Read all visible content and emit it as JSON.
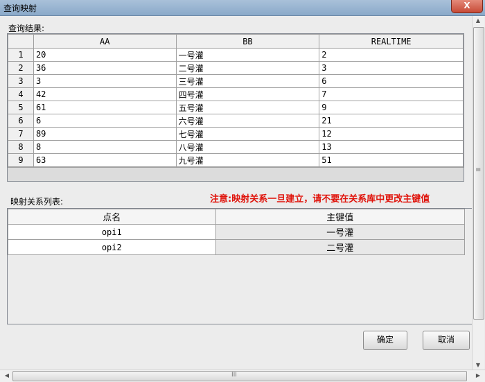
{
  "window": {
    "title": "查询映射",
    "close": "X"
  },
  "query": {
    "label": "查询结果:",
    "columns": [
      "AA",
      "BB",
      "REALTIME"
    ],
    "rows": [
      {
        "n": "1",
        "aa": "20",
        "bb": "一号灌",
        "rt": "2"
      },
      {
        "n": "2",
        "aa": "36",
        "bb": "二号灌",
        "rt": "3"
      },
      {
        "n": "3",
        "aa": "3",
        "bb": "三号灌",
        "rt": "6"
      },
      {
        "n": "4",
        "aa": "42",
        "bb": "四号灌",
        "rt": "7"
      },
      {
        "n": "5",
        "aa": "61",
        "bb": "五号灌",
        "rt": "9"
      },
      {
        "n": "6",
        "aa": "6",
        "bb": "六号灌",
        "rt": "21"
      },
      {
        "n": "7",
        "aa": "89",
        "bb": "七号灌",
        "rt": "12"
      },
      {
        "n": "8",
        "aa": "8",
        "bb": "八号灌",
        "rt": "13"
      },
      {
        "n": "9",
        "aa": "63",
        "bb": "九号灌",
        "rt": "51"
      }
    ]
  },
  "mapping": {
    "label": "映射关系列表:",
    "warning": "注意:映射关系一旦建立，请不要在关系库中更改主键值",
    "columns": [
      "点名",
      "主键值"
    ],
    "rows": [
      {
        "point": "opi1",
        "key": "一号灌"
      },
      {
        "point": "opi2",
        "key": "二号灌"
      }
    ]
  },
  "buttons": {
    "ok": "确定",
    "cancel": "取消"
  },
  "scroll": {
    "h_grip": "III",
    "v_grip": "≡"
  },
  "colors": {
    "warning": "#e0120a"
  }
}
